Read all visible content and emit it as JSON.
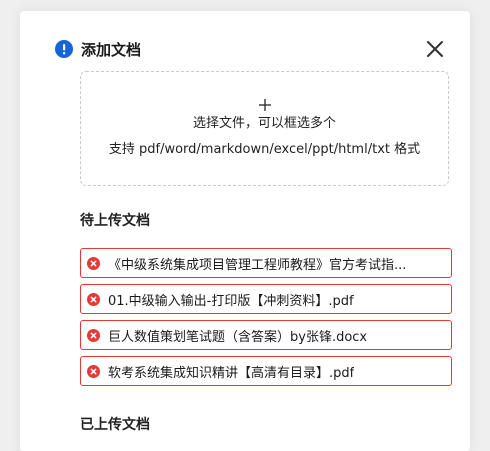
{
  "dialog": {
    "title": "添加文档",
    "close_icon": "close-icon",
    "info_icon": "info-icon"
  },
  "dropzone": {
    "plus": "+",
    "line1": "选择文件，可以框选多个",
    "line2": "支持 pdf/word/markdown/excel/ppt/html/txt 格式"
  },
  "pending": {
    "label": "待上传文档",
    "files": [
      {
        "name": "《中级系统集成项目管理工程师教程》官方考试指...",
        "icon": "error-icon",
        "status_color": "#e53935"
      },
      {
        "name": "01.中级输入输出-打印版【冲刺资料】.pdf",
        "icon": "error-icon",
        "status_color": "#e53935"
      },
      {
        "name": "巨人数值策划笔试题（含答案）by张锋.docx",
        "icon": "error-icon",
        "status_color": "#e53935"
      },
      {
        "name": "软考系统集成知识精讲【高清有目录】.pdf",
        "icon": "error-icon",
        "status_color": "#e53935"
      }
    ]
  },
  "uploaded": {
    "label": "已上传文档"
  },
  "colors": {
    "accent": "#1565d8",
    "error": "#e53935"
  }
}
